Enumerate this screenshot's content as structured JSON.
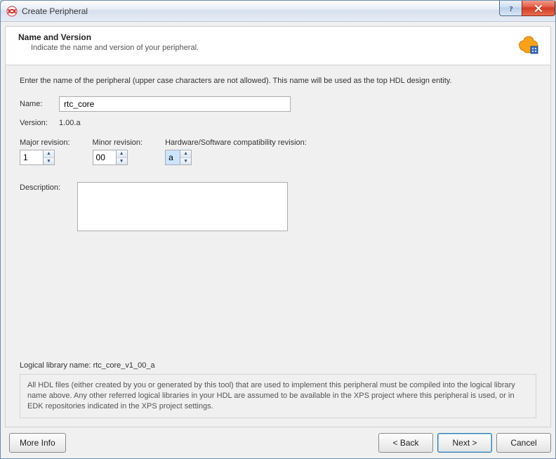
{
  "window": {
    "title": "Create Peripheral"
  },
  "header": {
    "title": "Name and Version",
    "subtitle": "Indicate the name and version of your peripheral."
  },
  "body": {
    "intro": "Enter the name of the peripheral (upper case characters are not allowed). This name will be used as the top HDL design entity.",
    "name_label": "Name:",
    "name_value": "rtc_core",
    "version_label": "Version:",
    "version_value": "1.00.a",
    "major_label": "Major revision:",
    "major_value": "1",
    "minor_label": "Minor revision:",
    "minor_value": "00",
    "compat_label": "Hardware/Software compatibility revision:",
    "compat_value": "a",
    "description_label": "Description:",
    "description_value": "",
    "libname_label": "Logical library name:",
    "libname_value": "rtc_core_v1_00_a",
    "libnote": "All HDL files (either created by you or generated by this tool) that are used to implement this peripheral must be compiled into the logical library name above. Any other referred logical libraries in your HDL are assumed to be available in the XPS project where this peripheral is used, or in EDK repositories indicated in the XPS project settings."
  },
  "footer": {
    "more_info": "More Info",
    "back": "< Back",
    "next": "Next >",
    "cancel": "Cancel"
  }
}
